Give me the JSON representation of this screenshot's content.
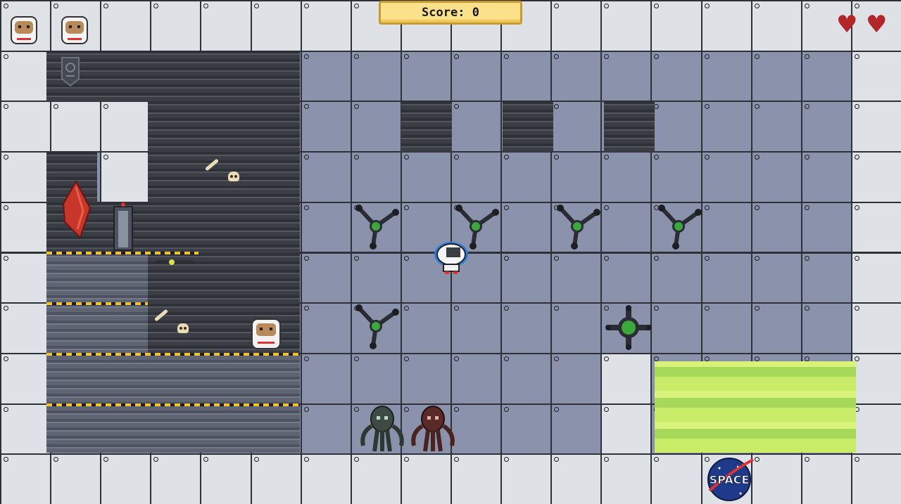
{
  "hud": {
    "score_label": "Score: 0",
    "lives_icons": [
      "astronaut-life-icon",
      "astronaut-life-icon"
    ],
    "hearts": 2,
    "heart_color": "#b2262a"
  },
  "level": {
    "grid_columns": 18,
    "grid_rows": 10,
    "wall_color": "#dee1e5",
    "floor_color": "#8a93ab",
    "acid_color": "#c8ec68",
    "logo_text": "SPACE"
  },
  "entities": {
    "player": "astronaut-player",
    "npc": "astronaut-npc",
    "drones": [
      "drone-enemy",
      "drone-enemy",
      "drone-enemy",
      "drone-enemy",
      "drone-enemy",
      "drone-enemy"
    ],
    "aliens": [
      "alien-enemy-green",
      "alien-enemy-red"
    ],
    "items": [
      "red-crystal",
      "teleporter-door",
      "shield-emblem",
      "bone",
      "skull"
    ]
  }
}
